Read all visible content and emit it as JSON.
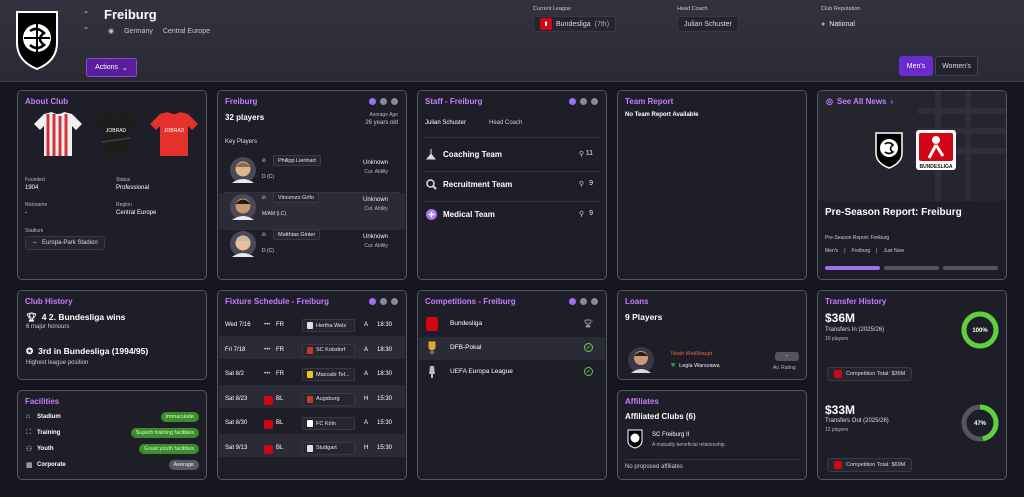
{
  "header": {
    "club_name": "Freiburg",
    "country": "Germany",
    "region": "Central Europe",
    "current_league_label": "Current League",
    "current_league": "Bundesliga",
    "current_league_pos": "(7th)",
    "head_coach_label": "Head Coach",
    "head_coach": "Julian Schuster",
    "reputation_label": "Club Reputation",
    "reputation": "National",
    "actions": "Actions",
    "tabs": [
      "Men's",
      "Women's"
    ]
  },
  "about": {
    "title": "About Club",
    "founded_label": "Founded",
    "founded": "1904",
    "status_label": "Status",
    "status": "Professional",
    "nickname_label": "Nickname",
    "nickname": "-",
    "region_label": "Region",
    "region": "Central Europe",
    "stadium_label": "Stadium",
    "stadium": "Europa-Park Stadion",
    "kit_sponsor": "JOBRAD"
  },
  "squad": {
    "title": "Freiburg",
    "players": "32 players",
    "avg_age_label": "Average Age",
    "avg_age": "26 years old",
    "key_players_label": "Key Players",
    "list": [
      {
        "name": "Philipp Lienhart",
        "pos": "D (C)",
        "ability": "Unknown",
        "ability_label": "Cur. Ability"
      },
      {
        "name": "Vincenzo Grifo",
        "pos": "M/AM (LC)",
        "ability": "Unknown",
        "ability_label": "Cur. Ability"
      },
      {
        "name": "Matthias Ginter",
        "pos": "D (C)",
        "ability": "Unknown",
        "ability_label": "Cur. Ability"
      }
    ]
  },
  "staff": {
    "title": "Staff - Freiburg",
    "coach_name": "Julian Schuster",
    "coach_role": "Head Coach",
    "teams": [
      {
        "label": "Coaching Team",
        "count": "11",
        "icon": "whistle-icon"
      },
      {
        "label": "Recruitment Team",
        "count": "9",
        "icon": "magnifier-icon"
      },
      {
        "label": "Medical Team",
        "count": "9",
        "icon": "medical-cross-icon"
      }
    ]
  },
  "report": {
    "title": "Team Report",
    "text": "No Team Report Available"
  },
  "news": {
    "link": "See All News",
    "headline": "Pre-Season Report: Freiburg",
    "sub": "Pre-Season Report: Freiburg",
    "tags": [
      "Men's",
      "Freiburg",
      "Just Now"
    ],
    "bundesliga_text": "BUNDESLIGA"
  },
  "history": {
    "title": "Club History",
    "item1": "4 2. Bundesliga wins",
    "item1_sub": "6 major honours",
    "item2": "3rd in Bundesliga (1994/95)",
    "item2_sub": "Highest league position"
  },
  "facilities": {
    "title": "Facilities",
    "items": [
      {
        "label": "Stadium",
        "value": "Immaculate",
        "color": "#3a8f2a"
      },
      {
        "label": "Training",
        "value": "Superb training facilities",
        "color": "#3a8f2a"
      },
      {
        "label": "Youth",
        "value": "Great youth facilities",
        "color": "#3a8f2a"
      },
      {
        "label": "Corporate",
        "value": "Average",
        "color": "#5a5a66"
      }
    ]
  },
  "fixtures": {
    "title": "Fixture Schedule - Freiburg",
    "list": [
      {
        "date": "Wed 7/16",
        "comp": "FR",
        "opp": "Hertha Wels",
        "venue": "A",
        "time": "18:30"
      },
      {
        "date": "Fri 7/18",
        "comp": "FR",
        "opp": "SC Kolsdorf",
        "venue": "A",
        "time": "18:30"
      },
      {
        "date": "Sat 8/2",
        "comp": "FR",
        "opp": "Maccabi Tel...",
        "venue": "A",
        "time": "18:30"
      },
      {
        "date": "Sat 8/23",
        "comp": "BL",
        "opp": "Augsburg",
        "venue": "H",
        "time": "15:30"
      },
      {
        "date": "Sat 8/30",
        "comp": "BL",
        "opp": "FC Köln",
        "venue": "A",
        "time": "15:30"
      },
      {
        "date": "Sat 9/13",
        "comp": "BL",
        "opp": "Stuttgart",
        "venue": "H",
        "time": "15:30"
      }
    ]
  },
  "competitions": {
    "title": "Competitions - Freiburg",
    "list": [
      "Bundesliga",
      "DFB-Pokal",
      "UEFA Europa League"
    ]
  },
  "loans": {
    "title": "Loans",
    "players": "9 Players",
    "player_name": "Noah Weißhaupt",
    "club": "Legia Warszawa",
    "rating": "-",
    "rating_label": "Av. Rating"
  },
  "affiliates": {
    "title": "Affiliates",
    "heading": "Affiliated Clubs (6)",
    "club": "SC Freiburg II",
    "club_sub": "A mutually beneficial relationship.",
    "proposed": "No proposed affiliates"
  },
  "transfers": {
    "title": "Transfer History",
    "in_amount": "$36M",
    "in_label": "Transfers In (2025/26)",
    "in_players": "10 players",
    "in_pct": "100%",
    "in_fraction": 1.0,
    "in_total": "Competition Total: $36M",
    "out_amount": "$33M",
    "out_label": "Transfers Out (2025/26)",
    "out_players": "12 players",
    "out_pct": "47%",
    "out_fraction": 0.47,
    "out_total": "Competition Total: $69M"
  }
}
